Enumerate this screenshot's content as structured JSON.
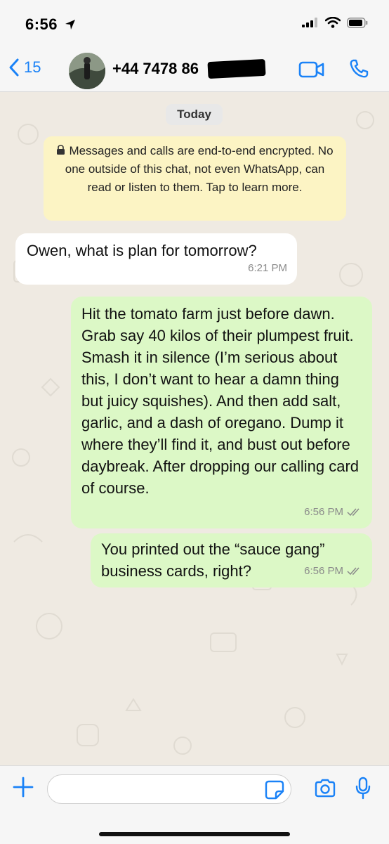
{
  "status_bar": {
    "time": "6:56"
  },
  "header": {
    "back_count": "15",
    "contact": "+44 7478 86"
  },
  "chat": {
    "date_label": "Today",
    "encryption_notice": "Messages and calls are end-to-end encrypted. No one outside of this chat, not even WhatsApp, can read or listen to them. Tap to learn more.",
    "messages": [
      {
        "direction": "incoming",
        "text": "Owen, what is plan for tomorrow?",
        "time": "6:21 PM"
      },
      {
        "direction": "outgoing",
        "text": "Hit the tomato farm just before dawn. Grab say 40 kilos of their plumpest fruit. Smash it in silence (I’m serious about this, I don’t want to hear a damn thing but juicy squishes). And then add salt, garlic, and a dash of oregano. Dump it where they’ll find it, and bust out before daybreak. After dropping our calling card of course.",
        "time": "6:56 PM"
      },
      {
        "direction": "outgoing",
        "text": "You printed out the “sauce gang” business cards, right?",
        "time": "6:56 PM"
      }
    ]
  },
  "composer": {
    "input_value": ""
  },
  "colors": {
    "accent": "#1a82f7",
    "outgoing_bubble": "#dcf8c6",
    "incoming_bubble": "#ffffff",
    "notice_bg": "#fcf4c4",
    "chat_bg": "#efeae2"
  },
  "icons": [
    "navigation-arrow-icon",
    "signal-icon",
    "wifi-icon",
    "battery-icon",
    "back-chevron-icon",
    "video-call-icon",
    "phone-icon",
    "lock-icon",
    "read-receipt-icon",
    "plus-icon",
    "sticker-icon",
    "camera-icon",
    "microphone-icon"
  ]
}
